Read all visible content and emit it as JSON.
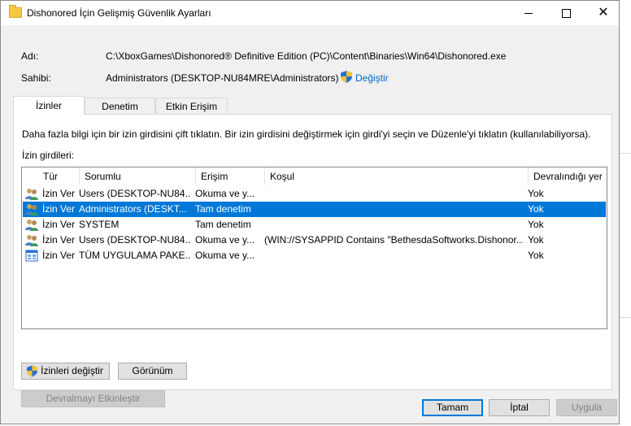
{
  "window": {
    "title": "Dishonored İçin Gelişmiş Güvenlik Ayarları",
    "minimize": "minimize",
    "maximize": "maximize",
    "close": "✕"
  },
  "info": {
    "name_label": "Adı:",
    "name_value": "C:\\XboxGames\\Dishonored® Definitive Edition (PC)\\Content\\Binaries\\Win64\\Dishonored.exe",
    "owner_label": "Sahibi:",
    "owner_value": "Administrators (DESKTOP-NU84MRE\\Administrators)",
    "change_link": "Değiştir"
  },
  "tabs": [
    {
      "label": "İzinler",
      "active": true
    },
    {
      "label": "Denetim",
      "active": false
    },
    {
      "label": "Etkin Erişim",
      "active": false
    }
  ],
  "panel": {
    "hint": "Daha fazla bilgi için bir izin girdisini çift tıklatın. Bir izin girdisini değiştirmek için girdi'yi seçin ve Düzenle'yi tıklatın (kullanılabiliyorsa).",
    "entries_label": "İzin girdileri:"
  },
  "columns": [
    "Tür",
    "Sorumlu",
    "Erişim",
    "Koşul",
    "Devralındığı yer"
  ],
  "rows": [
    {
      "icon": "users-icon",
      "type": "İzin Ver",
      "principal": "Users (DESKTOP-NU84...",
      "access": "Okuma ve y...",
      "condition": "",
      "inherited": "Yok",
      "selected": false
    },
    {
      "icon": "users-icon",
      "type": "İzin Ver",
      "principal": "Administrators (DESKT...",
      "access": "Tam denetim",
      "condition": "",
      "inherited": "Yok",
      "selected": true
    },
    {
      "icon": "users-icon",
      "type": "İzin Ver",
      "principal": "SYSTEM",
      "access": "Tam denetim",
      "condition": "",
      "inherited": "Yok",
      "selected": false
    },
    {
      "icon": "users-icon",
      "type": "İzin Ver",
      "principal": "Users (DESKTOP-NU84...",
      "access": "Okuma ve y...",
      "condition": "(WIN://SYSAPPID Contains \"BethesdaSoftworks.Dishonor...",
      "inherited": "Yok",
      "selected": false
    },
    {
      "icon": "app-package-icon",
      "type": "İzin Ver",
      "principal": "TÜM UYGULAMA PAKE...",
      "access": "Okuma ve y...",
      "condition": "",
      "inherited": "Yok",
      "selected": false
    }
  ],
  "buttons": {
    "change_permissions": "İzinleri değiştir",
    "view": "Görünüm",
    "enable_inheritance": "Devralmayı Etkinleştir",
    "ok": "Tamam",
    "cancel": "İptal",
    "apply": "Uygula"
  },
  "colors": {
    "selection": "#0078d7",
    "link": "#0066cc",
    "window_bg": "#f0f0f0"
  }
}
